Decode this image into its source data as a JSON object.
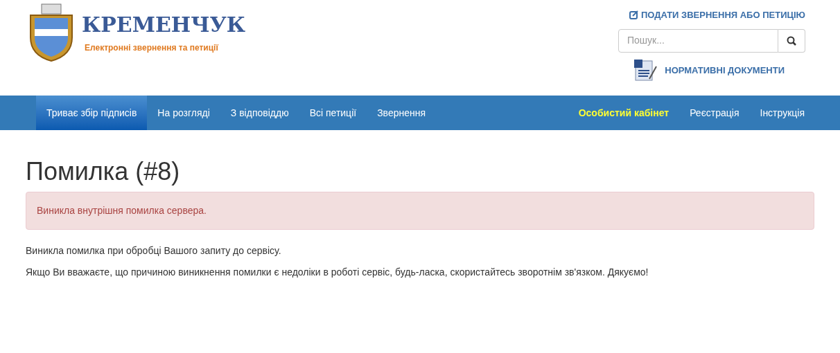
{
  "logo": {
    "title": "КРЕМЕНЧУК",
    "subtitle": "Електронні звернення та петиції"
  },
  "header_links": {
    "submit": "ПОДАТИ ЗВЕРНЕННЯ АБО ПЕТИЦІЮ",
    "documents": "НОРМАТИВНІ ДОКУМЕНТИ"
  },
  "search": {
    "placeholder": "Пошук..."
  },
  "nav_left": [
    {
      "label": "Триває збір підписів",
      "selected": true
    },
    {
      "label": "На розгляді",
      "selected": false
    },
    {
      "label": "З відповіддю",
      "selected": false
    },
    {
      "label": "Всі петиції",
      "selected": false
    },
    {
      "label": "Звернення",
      "selected": false
    }
  ],
  "nav_right": [
    {
      "label": "Особистий кабінет",
      "kind": "highlight"
    },
    {
      "label": "Реєстрація",
      "kind": "link"
    },
    {
      "label": "Інструкція",
      "kind": "link"
    }
  ],
  "heading": "Помилка (#8)",
  "alert": "Виникла внутрішня помилка сервера.",
  "paragraphs": [
    "Виникла помилка при обробці Вашого запиту до сервісу.",
    "Якщо Ви вважаєте, що причиною виникнення помилки є недоліки в роботі сервіс, будь-ласка, скористайтесь зворотнім зв'язком. Дякуємо!"
  ]
}
